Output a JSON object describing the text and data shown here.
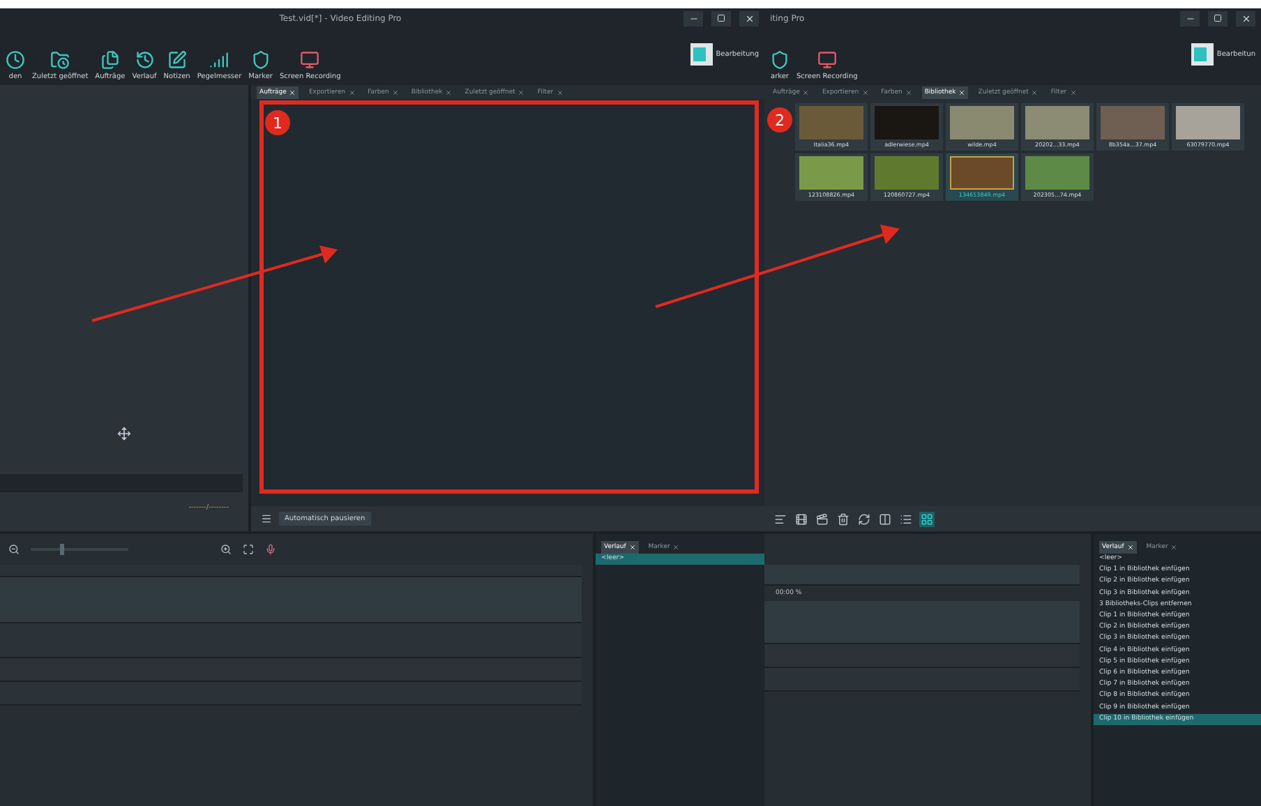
{
  "left_window": {
    "title": "Test.vid[*] - Video Editing Pro",
    "toolbar": [
      "den",
      "Zuletzt geöffnet",
      "Aufträge",
      "Verlauf",
      "Notizen",
      "Pegelmesser",
      "Marker",
      "Screen Recording"
    ],
    "layout_button": "Bearbeitung",
    "preview": {
      "timecode": "-------/--------"
    },
    "panel_tabs": [
      {
        "label": "Aufträge",
        "selected": true
      },
      {
        "label": "Exportieren",
        "selected": false
      },
      {
        "label": "Farben",
        "selected": false
      },
      {
        "label": "Bibliothek",
        "selected": false
      },
      {
        "label": "Zuletzt geöffnet",
        "selected": false
      },
      {
        "label": "Filter",
        "selected": false
      }
    ],
    "panel_button": "Automatisch pausieren",
    "timeline_zoom": {
      "level": 0.3
    },
    "history": {
      "tabs": [
        {
          "label": "Verlauf",
          "selected": true
        },
        {
          "label": "Marker",
          "selected": false
        }
      ],
      "items": [
        {
          "label": "<leer>",
          "selected": true
        }
      ]
    }
  },
  "right_window": {
    "title": "iting Pro",
    "toolbar": [
      "arker",
      "Screen Recording"
    ],
    "layout_button": "Bearbeitun",
    "panel_tabs": [
      {
        "label": "Aufträge",
        "selected": false
      },
      {
        "label": "Exportieren",
        "selected": false
      },
      {
        "label": "Farben",
        "selected": false
      },
      {
        "label": "Bibliothek",
        "selected": true
      },
      {
        "label": "Zuletzt geöffnet",
        "selected": false
      },
      {
        "label": "Filter",
        "selected": false
      }
    ],
    "library": [
      {
        "name": "Italia36.mp4",
        "selected": false
      },
      {
        "name": "adlerwiese.mp4",
        "selected": false
      },
      {
        "name": "wilde.mp4",
        "selected": false
      },
      {
        "name": "20202...33.mp4",
        "selected": false
      },
      {
        "name": "8b354a...37.mp4",
        "selected": false
      },
      {
        "name": "63079770.mp4",
        "selected": false
      },
      {
        "name": "123108826.mp4",
        "selected": false
      },
      {
        "name": "120860727.mp4",
        "selected": false
      },
      {
        "name": "134653849.mp4",
        "selected": true
      },
      {
        "name": "202305...74.mp4",
        "selected": false
      }
    ],
    "view_buttons": [
      {
        "selected": false
      },
      {
        "selected": false
      },
      {
        "selected": false
      },
      {
        "selected": false
      },
      {
        "selected": false
      },
      {
        "selected": false
      },
      {
        "selected": false
      },
      {
        "selected": true
      }
    ],
    "timeline_reading": "00:00 %",
    "history": {
      "tabs": [
        {
          "label": "Verlauf",
          "selected": true
        },
        {
          "label": "Marker",
          "selected": false
        }
      ],
      "items": [
        {
          "label": "<leer>",
          "selected": false
        },
        {
          "label": "Clip 1 in Bibliothek einfügen",
          "selected": false
        },
        {
          "label": "Clip 2 in Bibliothek einfügen",
          "selected": false
        },
        {
          "label": "Clip 3 in Bibliothek einfügen",
          "selected": false
        },
        {
          "label": "3 Bibliotheks-Clips entfernen",
          "selected": false
        },
        {
          "label": "Clip 1 in Bibliothek einfügen",
          "selected": false
        },
        {
          "label": "Clip 2 in Bibliothek einfügen",
          "selected": false
        },
        {
          "label": "Clip 3 in Bibliothek einfügen",
          "selected": false
        },
        {
          "label": "Clip 4 in Bibliothek einfügen",
          "selected": false
        },
        {
          "label": "Clip 5 in Bibliothek einfügen",
          "selected": false
        },
        {
          "label": "Clip 6 in Bibliothek einfügen",
          "selected": false
        },
        {
          "label": "Clip 7 in Bibliothek einfügen",
          "selected": false
        },
        {
          "label": "Clip 8 in Bibliothek einfügen",
          "selected": false
        },
        {
          "label": "Clip 9 in Bibliothek einfügen",
          "selected": false
        },
        {
          "label": "Clip 10 in Bibliothek einfügen",
          "selected": true
        }
      ]
    }
  },
  "annotations": [
    {
      "label": "1"
    },
    {
      "label": "2"
    }
  ]
}
